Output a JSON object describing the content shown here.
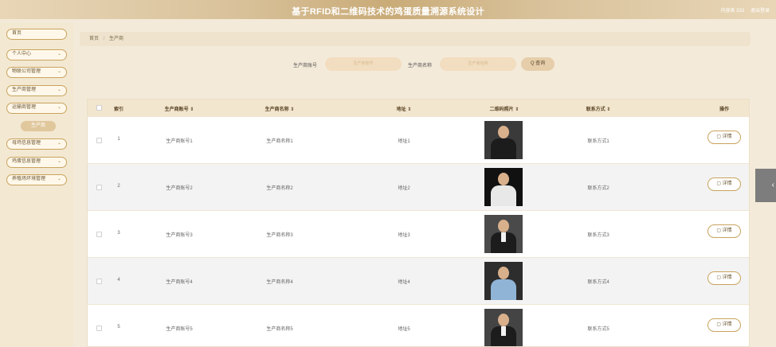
{
  "header": {
    "title": "基于RFID和二维码技术的鸡蛋质量溯源系统设计",
    "user": "内容表 333",
    "logout": "退出登录"
  },
  "sidebar": {
    "items": [
      {
        "label": "首页",
        "chevron": ""
      },
      {
        "label": "个人中心",
        "chevron": "⌄"
      },
      {
        "label": "物联公司管理",
        "chevron": "⌄"
      },
      {
        "label": "生产商管理",
        "chevron": "⌄"
      },
      {
        "label": "运输商管理",
        "chevron": "⌄"
      },
      {
        "label": "母鸡信息管理",
        "chevron": "⌄"
      },
      {
        "label": "鸡蛋信息管理",
        "chevron": "⌄"
      },
      {
        "label": "养殖场环境管理",
        "chevron": "⌄"
      }
    ],
    "submenu_label": "生产商"
  },
  "breadcrumb": {
    "home": "首页",
    "sep": "/",
    "current": "生产商"
  },
  "search": {
    "account_label": "生产商账号",
    "account_placeholder": "生产商账号",
    "name_label": "生产商名称",
    "name_placeholder": "生产商名称",
    "button_label": "Q 查询"
  },
  "table": {
    "headers": [
      "索引",
      "生产商账号 ⇕",
      "生产商名称 ⇕",
      "地址 ⇕",
      "二维码照片 ⇕",
      "联系方式 ⇕",
      "操作"
    ],
    "detail_label": "▢ 详情",
    "rows": [
      {
        "index": "1",
        "account": "生产商账号1",
        "name": "生产商名称1",
        "address": "地址1",
        "contact": "联系方式1"
      },
      {
        "index": "2",
        "account": "生产商账号2",
        "name": "生产商名称2",
        "address": "地址2",
        "contact": "联系方式2"
      },
      {
        "index": "3",
        "account": "生产商账号3",
        "name": "生产商名称3",
        "address": "地址3",
        "contact": "联系方式3"
      },
      {
        "index": "4",
        "account": "生产商账号4",
        "name": "生产商名称4",
        "address": "地址4",
        "contact": "联系方式4"
      },
      {
        "index": "5",
        "account": "生产商账号5",
        "name": "生产商名称5",
        "address": "地址5",
        "contact": "联系方式5"
      }
    ]
  },
  "side_tab": {
    "icon": "‹"
  }
}
